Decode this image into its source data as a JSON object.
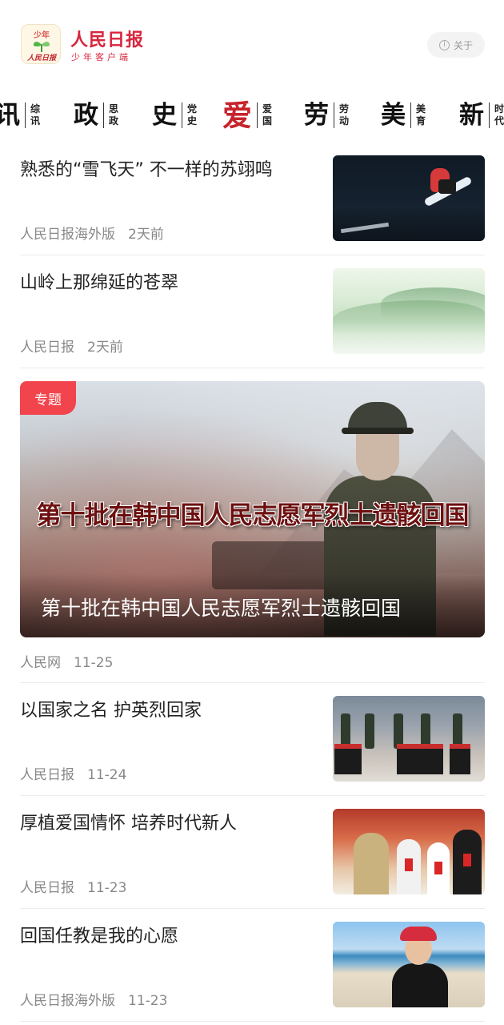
{
  "header": {
    "logo_top": "少年",
    "logo_bottom": "人民日报",
    "brand_title": "人民日报",
    "brand_subtitle": "少年客户端",
    "about_label": "关于"
  },
  "categories": [
    {
      "big": "讯",
      "small": "综讯",
      "active": false
    },
    {
      "big": "政",
      "small": "思政",
      "active": false
    },
    {
      "big": "史",
      "small": "党史",
      "active": false
    },
    {
      "big": "爱",
      "small": "爱国",
      "active": true
    },
    {
      "big": "劳",
      "small": "劳动",
      "active": false
    },
    {
      "big": "美",
      "small": "美育",
      "active": false
    },
    {
      "big": "新",
      "small": "时代",
      "active": false
    }
  ],
  "feed": [
    {
      "title": "熟悉的“雪飞天” 不一样的苏翊鸣",
      "source": "人民日报海外版",
      "time": "2天前",
      "thumb_icon": "snowboard-image"
    },
    {
      "title": "山岭上那绵延的苍翠",
      "source": "人民日报",
      "time": "2天前",
      "thumb_icon": "mountain-mist-image"
    }
  ],
  "feature": {
    "badge": "专题",
    "headline_art": "第十批在韩中国人民志愿军烈士遗骸回国",
    "caption": "第十批在韩中国人民志愿军烈士遗骸回国",
    "source": "人民网",
    "time": "11-25"
  },
  "feed2": [
    {
      "title": "以国家之名 护英烈回家",
      "source": "人民日报",
      "time": "11-24",
      "thumb_icon": "honor-guard-image"
    },
    {
      "title": "厚植爱国情怀 培养时代新人",
      "source": "人民日报",
      "time": "11-23",
      "thumb_icon": "veteran-kids-image"
    },
    {
      "title": "回国任教是我的心愿",
      "source": "人民日报海外版",
      "time": "11-23",
      "thumb_icon": "beach-portrait-image"
    }
  ],
  "colors": {
    "brand_red": "#d7263d",
    "badge_red": "#f2444c",
    "meta_gray": "#888888"
  }
}
